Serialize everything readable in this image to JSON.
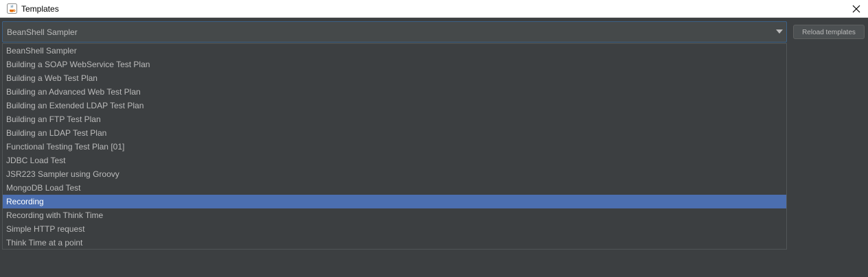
{
  "window": {
    "title": "Templates",
    "icon": "java-coffee-cup-icon",
    "close_icon": "close-icon"
  },
  "combo": {
    "selected_value": "BeanShell Sampler",
    "arrow_icon": "triangle-down-icon"
  },
  "reload_button": {
    "label": "Reload templates"
  },
  "dropdown": {
    "selected_index": 11,
    "items": [
      "BeanShell Sampler",
      "Building a SOAP WebService Test Plan",
      "Building a Web Test Plan",
      "Building an Advanced Web Test Plan",
      "Building an Extended LDAP Test Plan",
      "Building an FTP Test Plan",
      "Building an LDAP Test Plan",
      "Functional Testing Test Plan [01]",
      "JDBC Load Test",
      "JSR223 Sampler using Groovy",
      "MongoDB Load Test",
      "Recording",
      "Recording with Think Time",
      "Simple HTTP request",
      "Think Time at a point"
    ]
  },
  "colors": {
    "background": "#3c3f41",
    "text": "#bbbbbb",
    "selection": "#4b6eaf",
    "focus_border": "#3d6185",
    "titlebar": "#ffffff"
  }
}
